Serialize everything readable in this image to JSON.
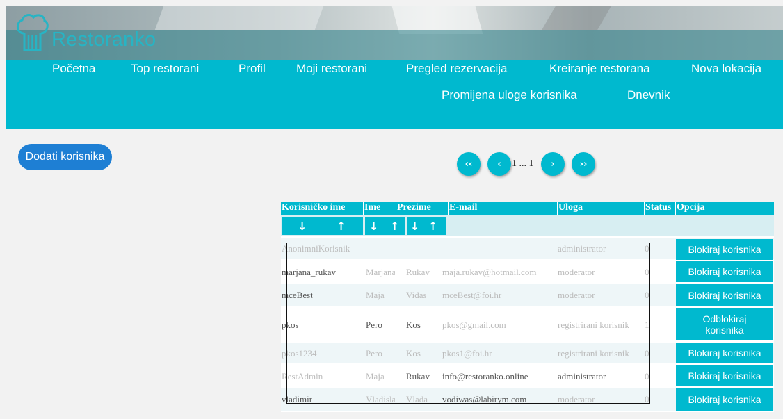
{
  "header": {
    "app_name": "Restoranko",
    "logo_icon": "chef-hat-icon"
  },
  "nav": {
    "items": [
      "Početna",
      "Top restorani",
      "Profil",
      "Moji restorani",
      "Pregled rezervacija",
      "Kreiranje restorana",
      "Nova lokacija",
      "Promijena uloge korisnika",
      "Dnevnik"
    ]
  },
  "actions": {
    "add_user": "Dodati korisnika"
  },
  "pagination": {
    "first": "‹‹",
    "prev": "‹",
    "page_text": "1 ... 1",
    "next": "›",
    "last": "››"
  },
  "table": {
    "headers": [
      "Korisničko ime",
      "Ime",
      "Prezime",
      "E-mail",
      "Uloga",
      "Status",
      "Opcija"
    ],
    "sort_icons": {
      "down": "↓",
      "up": "↑"
    },
    "rows": [
      {
        "username": "AnonimniKorisnik",
        "ime": "",
        "prezime": "",
        "email": "",
        "uloga": "administrator",
        "status": "0",
        "action": "Blokiraj korisnika"
      },
      {
        "username": "marjana_rukav",
        "ime": "Marjana",
        "prezime": "Rukav",
        "email": "maja.rukav@hotmail.com",
        "uloga": "moderator",
        "status": "0",
        "action": "Blokiraj korisnika"
      },
      {
        "username": "mceBest",
        "ime": "Maja",
        "prezime": "Vidas",
        "email": "mceBest@foi.hr",
        "uloga": "moderator",
        "status": "0",
        "action": "Blokiraj korisnika"
      },
      {
        "username": "pkos",
        "ime": "Pero",
        "prezime": "Kos",
        "email": "pkos@gmail.com",
        "uloga": "registrirani korisnik",
        "status": "1",
        "action": "Odblokiraj korisnika"
      },
      {
        "username": "pkos1234",
        "ime": "Pero",
        "prezime": "Kos",
        "email": "pkos1@foi.hr",
        "uloga": "registrirani korisnik",
        "status": "0",
        "action": "Blokiraj korisnika"
      },
      {
        "username": "RestAdmin",
        "ime": "Maja",
        "prezime": "Rukav",
        "email": "info@restoranko.online",
        "uloga": "administrator",
        "status": "0",
        "action": "Blokiraj korisnika"
      },
      {
        "username": "vladimir",
        "ime": "Vladislav",
        "prezime": "Vlada",
        "email": "vodiwas@labirym.com",
        "uloga": "moderator",
        "status": "0",
        "action": "Blokiraj korisnika"
      }
    ]
  },
  "colors": {
    "primary": "#00b9cf",
    "add_button": "#1e7fd4",
    "row_alt": "#eef6f8"
  }
}
